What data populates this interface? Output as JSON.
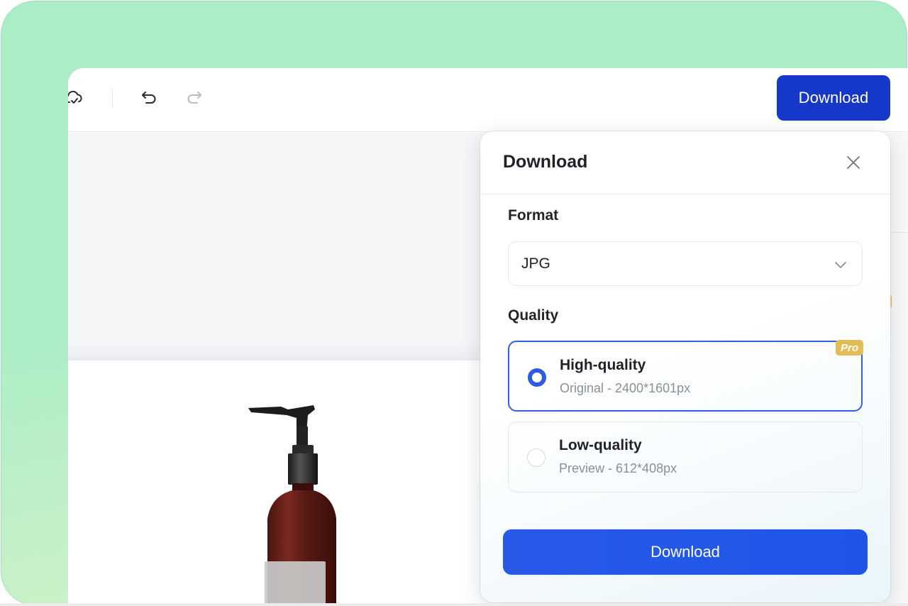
{
  "toolbar": {
    "icons": [
      {
        "name": "cloud-saved-icon",
        "enabled": true
      },
      {
        "name": "undo-icon",
        "enabled": true
      },
      {
        "name": "redo-icon",
        "enabled": false
      }
    ],
    "download_label": "Download"
  },
  "dialog": {
    "title": "Download",
    "close_icon": "close-icon",
    "format": {
      "label": "Format",
      "selected": "JPG"
    },
    "quality": {
      "label": "Quality",
      "options": [
        {
          "title": "High-quality",
          "subtitle": "Original - 2400*1601px",
          "selected": true,
          "badge": "Pro"
        },
        {
          "title": "Low-quality",
          "subtitle": "Preview - 612*408px",
          "selected": false
        }
      ]
    },
    "download_label": "Download"
  },
  "colors": {
    "background_green": "#abedc6",
    "toolbar_button": "#1538c8",
    "primary_blue": "#2459e8",
    "pro_badge": "#e3bc55"
  }
}
